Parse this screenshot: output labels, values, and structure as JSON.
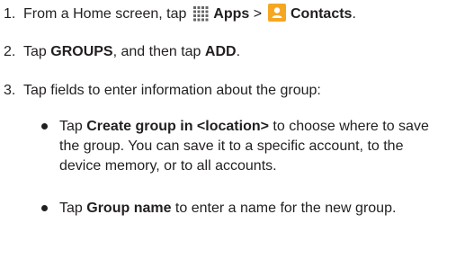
{
  "steps": [
    {
      "number": "1.",
      "prefix": "From a Home screen, tap ",
      "apps_label": "Apps",
      "separator": " > ",
      "contacts_label": "Contacts",
      "suffix": "."
    },
    {
      "number": "2.",
      "prefix": "Tap ",
      "groups_label": "GROUPS",
      "middle": ", and then tap ",
      "add_label": "ADD",
      "suffix": "."
    },
    {
      "number": "3.",
      "text": "Tap fields to enter information about the group:"
    }
  ],
  "bullets": [
    {
      "prefix": "Tap ",
      "bold": "Create group in <location>",
      "rest": " to choose where to save the group. You can save it to a specific account, to the device memory, or to all accounts."
    },
    {
      "prefix": "Tap ",
      "bold": "Group name",
      "rest": " to enter a name for the new group."
    }
  ],
  "icons": {
    "apps": "apps-grid-icon",
    "contacts": "contacts-icon",
    "contacts_color": "#f5a623"
  }
}
